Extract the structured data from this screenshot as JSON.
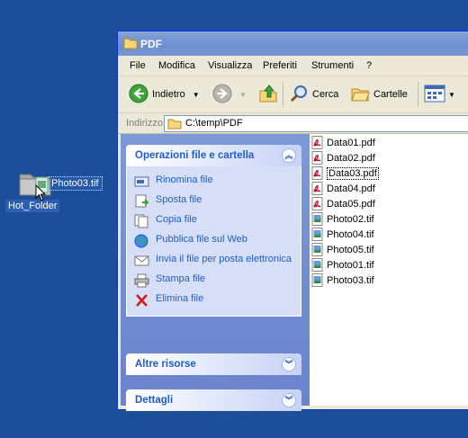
{
  "desktop": {
    "folder_label": "Hot_Folder",
    "dragged_file": "Photo03.tif"
  },
  "window": {
    "title": "PDF",
    "menu": [
      "File",
      "Modifica",
      "Visualizza",
      "Preferiti",
      "Strumenti",
      "?"
    ],
    "toolbar": {
      "back_label": "Indietro",
      "search_label": "Cerca",
      "folders_label": "Cartelle"
    },
    "address": {
      "label": "Indirizzo",
      "path": "C:\\temp\\PDF"
    },
    "taskpane": {
      "file_tasks": {
        "title": "Operazioni file e cartella",
        "items": [
          {
            "label": "Rinomina file",
            "icon": "rename-icon"
          },
          {
            "label": "Sposta file",
            "icon": "move-icon"
          },
          {
            "label": "Copia file",
            "icon": "copy-icon"
          },
          {
            "label": "Pubblica file sul Web",
            "icon": "globe-icon"
          },
          {
            "label": "Invia il file per posta elettronica",
            "icon": "mail-icon"
          },
          {
            "label": "Stampa file",
            "icon": "printer-icon"
          },
          {
            "label": "Elimina file",
            "icon": "delete-icon"
          }
        ]
      },
      "other_places": {
        "title": "Altre risorse"
      },
      "details": {
        "title": "Dettagli"
      }
    },
    "files": [
      {
        "name": "Data01.pdf",
        "type": "pdf"
      },
      {
        "name": "Data02.pdf",
        "type": "pdf"
      },
      {
        "name": "Data03.pdf",
        "type": "pdf",
        "selected": true
      },
      {
        "name": "Data04.pdf",
        "type": "pdf"
      },
      {
        "name": "Data05.pdf",
        "type": "pdf"
      },
      {
        "name": "Photo02.tif",
        "type": "tif"
      },
      {
        "name": "Photo04.tif",
        "type": "tif"
      },
      {
        "name": "Photo05.tif",
        "type": "tif"
      },
      {
        "name": "Photo01.tif",
        "type": "tif"
      },
      {
        "name": "Photo03.tif",
        "type": "tif"
      }
    ]
  },
  "colors": {
    "desktop": "#1c4e9a",
    "link_blue": "#215dc6",
    "pane_bg": "#d6dff7"
  }
}
